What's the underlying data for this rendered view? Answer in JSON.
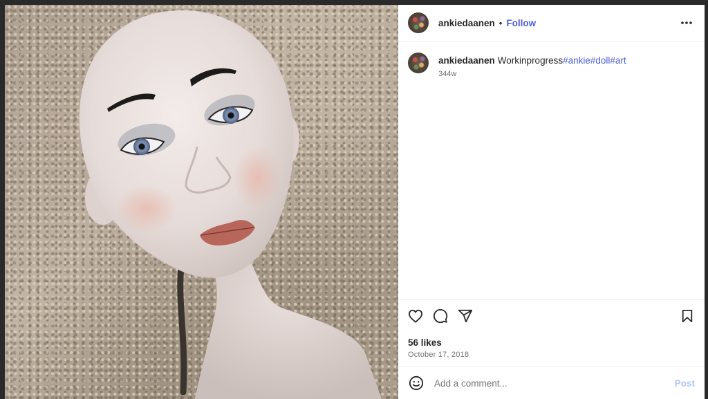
{
  "post": {
    "username": "ankiedaanen",
    "follow_label": "Follow",
    "dot": "•",
    "caption": {
      "username": "ankiedaanen",
      "text": "Workinprogress",
      "hashtags": [
        "#ankie",
        "#doll",
        "#art"
      ],
      "age": "344w"
    },
    "likes": "56 likes",
    "date": "October 17, 2018"
  },
  "comment_box": {
    "placeholder": "Add a comment...",
    "post_label": "Post"
  },
  "icons": {
    "more": "more-horizontal-icon",
    "like": "heart-icon",
    "comment": "comment-bubble-icon",
    "share": "paper-plane-icon",
    "save": "bookmark-icon",
    "emoji": "smiley-icon"
  },
  "colors": {
    "link": "#4c5fd5",
    "post_disabled": "#b3c8f5",
    "text": "#262626",
    "secondary": "#737373"
  }
}
